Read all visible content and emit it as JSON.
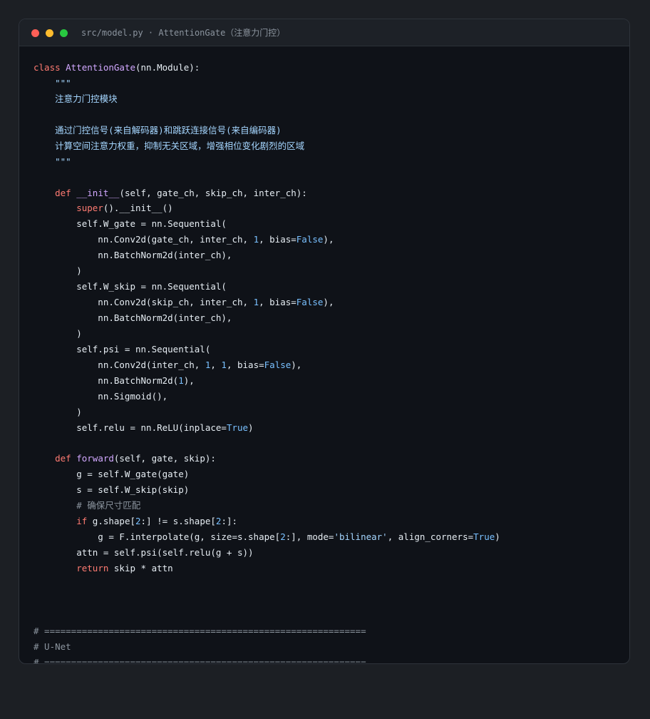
{
  "window": {
    "title": "src/model.py · AttentionGate（注意力门控）"
  },
  "colors": {
    "background": "#1c1f24",
    "editor_background": "#0f1218",
    "titlebar_background": "#1d2127",
    "keyword": "#ff7b72",
    "function": "#d2a8ff",
    "number": "#79c0ff",
    "string": "#a5d6ff",
    "comment": "#8b949e",
    "plain": "#e6edf3"
  },
  "code": {
    "lines": [
      [
        {
          "t": "class ",
          "c": "kw"
        },
        {
          "t": "AttentionGate",
          "c": "fn"
        },
        {
          "t": "(nn.Module):",
          "c": "pl"
        }
      ],
      [
        {
          "t": "    \"\"\"",
          "c": "doc"
        }
      ],
      [
        {
          "t": "    注意力门控模块",
          "c": "doc"
        }
      ],
      [],
      [
        {
          "t": "    通过门控信号(来自解码器)和跳跃连接信号(来自编码器)",
          "c": "doc"
        }
      ],
      [
        {
          "t": "    计算空间注意力权重，抑制无关区域，增强相位变化剧烈的区域",
          "c": "doc"
        }
      ],
      [
        {
          "t": "    \"\"\"",
          "c": "doc"
        }
      ],
      [],
      [
        {
          "t": "    ",
          "c": "pl"
        },
        {
          "t": "def ",
          "c": "kw"
        },
        {
          "t": "__init__",
          "c": "fn"
        },
        {
          "t": "(self, gate_ch, skip_ch, inter_ch):",
          "c": "pl"
        }
      ],
      [
        {
          "t": "        ",
          "c": "pl"
        },
        {
          "t": "super",
          "c": "kw"
        },
        {
          "t": "().__init__()",
          "c": "pl"
        }
      ],
      [
        {
          "t": "        self.W_gate = nn.Sequential(",
          "c": "pl"
        }
      ],
      [
        {
          "t": "            nn.Conv2d(gate_ch, inter_ch, ",
          "c": "pl"
        },
        {
          "t": "1",
          "c": "num"
        },
        {
          "t": ", bias=",
          "c": "pl"
        },
        {
          "t": "False",
          "c": "num"
        },
        {
          "t": "),",
          "c": "pl"
        }
      ],
      [
        {
          "t": "            nn.BatchNorm2d(inter_ch),",
          "c": "pl"
        }
      ],
      [
        {
          "t": "        )",
          "c": "pl"
        }
      ],
      [
        {
          "t": "        self.W_skip = nn.Sequential(",
          "c": "pl"
        }
      ],
      [
        {
          "t": "            nn.Conv2d(skip_ch, inter_ch, ",
          "c": "pl"
        },
        {
          "t": "1",
          "c": "num"
        },
        {
          "t": ", bias=",
          "c": "pl"
        },
        {
          "t": "False",
          "c": "num"
        },
        {
          "t": "),",
          "c": "pl"
        }
      ],
      [
        {
          "t": "            nn.BatchNorm2d(inter_ch),",
          "c": "pl"
        }
      ],
      [
        {
          "t": "        )",
          "c": "pl"
        }
      ],
      [
        {
          "t": "        self.psi = nn.Sequential(",
          "c": "pl"
        }
      ],
      [
        {
          "t": "            nn.Conv2d(inter_ch, ",
          "c": "pl"
        },
        {
          "t": "1",
          "c": "num"
        },
        {
          "t": ", ",
          "c": "pl"
        },
        {
          "t": "1",
          "c": "num"
        },
        {
          "t": ", bias=",
          "c": "pl"
        },
        {
          "t": "False",
          "c": "num"
        },
        {
          "t": "),",
          "c": "pl"
        }
      ],
      [
        {
          "t": "            nn.BatchNorm2d(",
          "c": "pl"
        },
        {
          "t": "1",
          "c": "num"
        },
        {
          "t": "),",
          "c": "pl"
        }
      ],
      [
        {
          "t": "            nn.Sigmoid(),",
          "c": "pl"
        }
      ],
      [
        {
          "t": "        )",
          "c": "pl"
        }
      ],
      [
        {
          "t": "        self.relu = nn.ReLU(inplace=",
          "c": "pl"
        },
        {
          "t": "True",
          "c": "num"
        },
        {
          "t": ")",
          "c": "pl"
        }
      ],
      [],
      [
        {
          "t": "    ",
          "c": "pl"
        },
        {
          "t": "def ",
          "c": "kw"
        },
        {
          "t": "forward",
          "c": "fn"
        },
        {
          "t": "(self, gate, skip):",
          "c": "pl"
        }
      ],
      [
        {
          "t": "        g = self.W_gate(gate)",
          "c": "pl"
        }
      ],
      [
        {
          "t": "        s = self.W_skip(skip)",
          "c": "pl"
        }
      ],
      [
        {
          "t": "        # 确保尺寸匹配",
          "c": "cmt"
        }
      ],
      [
        {
          "t": "        ",
          "c": "pl"
        },
        {
          "t": "if ",
          "c": "kw"
        },
        {
          "t": "g.shape[",
          "c": "pl"
        },
        {
          "t": "2",
          "c": "num"
        },
        {
          "t": ":] != s.shape[",
          "c": "pl"
        },
        {
          "t": "2",
          "c": "num"
        },
        {
          "t": ":]:",
          "c": "pl"
        }
      ],
      [
        {
          "t": "            g = F.interpolate(g, size=s.shape[",
          "c": "pl"
        },
        {
          "t": "2",
          "c": "num"
        },
        {
          "t": ":], mode=",
          "c": "pl"
        },
        {
          "t": "'bilinear'",
          "c": "str"
        },
        {
          "t": ", align_corners=",
          "c": "pl"
        },
        {
          "t": "True",
          "c": "num"
        },
        {
          "t": ")",
          "c": "pl"
        }
      ],
      [
        {
          "t": "        attn = self.psi(self.relu(g + s))",
          "c": "pl"
        }
      ],
      [
        {
          "t": "        ",
          "c": "pl"
        },
        {
          "t": "return ",
          "c": "kw"
        },
        {
          "t": "skip * attn",
          "c": "pl"
        }
      ],
      [],
      [],
      [],
      [
        {
          "t": "# ============================================================",
          "c": "cmt"
        }
      ],
      [
        {
          "t": "# U-Net",
          "c": "cmt"
        }
      ],
      [
        {
          "t": "# ============================================================",
          "c": "cmt"
        }
      ]
    ]
  }
}
